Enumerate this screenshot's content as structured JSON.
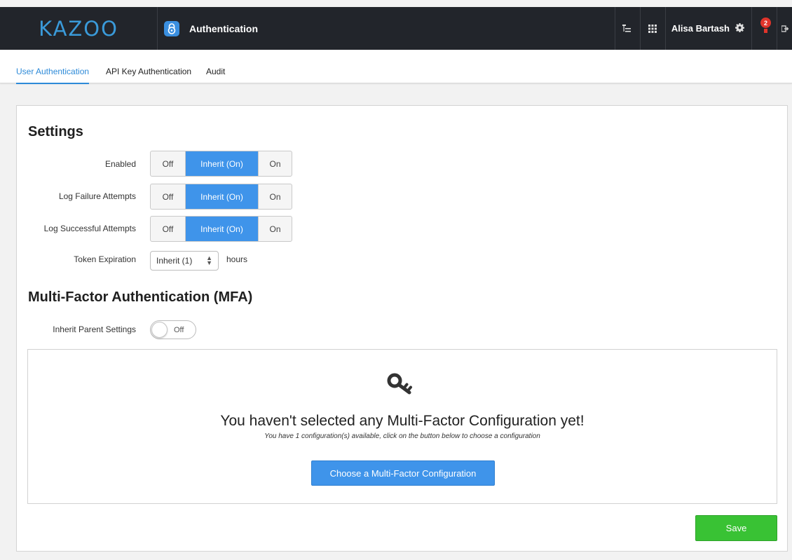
{
  "header": {
    "logo": "KAZOO",
    "app_name": "Authentication",
    "user_name": "Alisa Bartash",
    "notification_count": "2"
  },
  "tabs": [
    {
      "label": "User Authentication",
      "active": true
    },
    {
      "label": "API Key Authentication",
      "active": false
    },
    {
      "label": "Audit",
      "active": false
    }
  ],
  "settings": {
    "title": "Settings",
    "rows": [
      {
        "label": "Enabled",
        "options": [
          "Off",
          "Inherit (On)",
          "On"
        ],
        "selected": "Inherit (On)"
      },
      {
        "label": "Log Failure Attempts",
        "options": [
          "Off",
          "Inherit (On)",
          "On"
        ],
        "selected": "Inherit (On)"
      },
      {
        "label": "Log Successful Attempts",
        "options": [
          "Off",
          "Inherit (On)",
          "On"
        ],
        "selected": "Inherit (On)"
      }
    ],
    "token_expiration": {
      "label": "Token Expiration",
      "value": "Inherit (1)",
      "unit": "hours"
    }
  },
  "mfa": {
    "title": "Multi-Factor Authentication (MFA)",
    "inherit_label": "Inherit Parent Settings",
    "inherit_toggle": "Off",
    "empty_title": "You haven't selected any Multi-Factor Configuration yet!",
    "empty_subtitle": "You have 1 configuration(s) available, click on the button below to choose a configuration",
    "choose_button": "Choose a Multi-Factor Configuration"
  },
  "actions": {
    "save": "Save"
  },
  "colors": {
    "accent": "#3f94ea",
    "save": "#39c234",
    "topbar": "#22252b",
    "badge": "#e0342b"
  }
}
